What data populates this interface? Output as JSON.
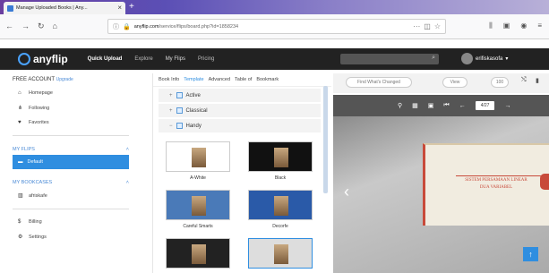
{
  "browser": {
    "tab_title": "Manage Uploaded Books | Any...",
    "url_host": "anyflip.com",
    "url_rest": "/service/flips/board.php?id=1858234"
  },
  "header": {
    "logo": "anyflip",
    "nav": [
      "Quick Upload",
      "Explore",
      "My Flips",
      "Pricing"
    ],
    "user": "erifiskasofa"
  },
  "sidebar": {
    "account_title": "FREE ACCOUNT",
    "upgrade": "Upgrade",
    "items": [
      "Homepage",
      "Following",
      "Favorites"
    ],
    "flips_section": "MY FLIPS",
    "selected_folder": "Default",
    "bookcases_section": "MY BOOKCASES",
    "bookcase_item": "afriskafe",
    "bottom_items": [
      "Billing",
      "Settings"
    ]
  },
  "middle": {
    "tabs": [
      "Book Info",
      "Template",
      "Advanced",
      "Table of",
      "Bookmark"
    ],
    "tree": [
      "Active",
      "Classical",
      "Handy"
    ],
    "thumbs": [
      {
        "label": "A-White",
        "bg": "#ffffff"
      },
      {
        "label": "Black",
        "bg": "#111111"
      },
      {
        "label": "Careful Smarts",
        "bg": "#4a7ab8"
      },
      {
        "label": "Decorfe",
        "bg": "#2a5aa8"
      },
      {
        "label": "",
        "bg": "#222222"
      },
      {
        "label": "",
        "bg": "#dddddd"
      }
    ]
  },
  "viewer": {
    "btn_left": "Find What's Changed",
    "btn_view": "View",
    "zoom": "100",
    "page_input": "4/27",
    "cover_title_1": "SISTEM PERSAMAAN LINEAR",
    "cover_title_2": "DUA VARIABEL"
  }
}
